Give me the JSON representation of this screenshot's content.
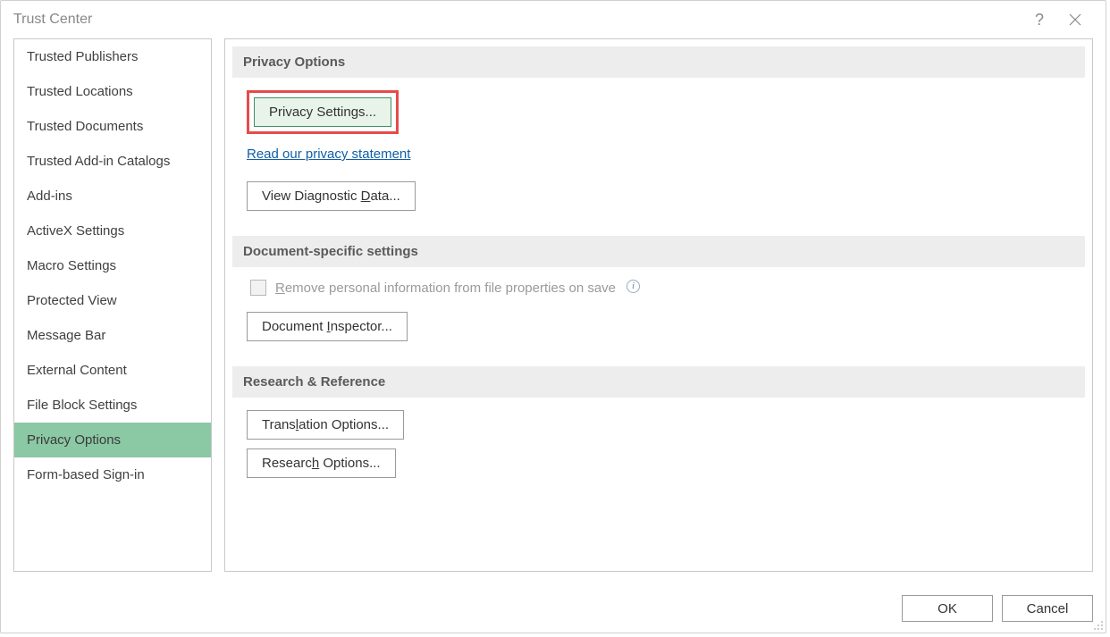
{
  "window": {
    "title": "Trust Center",
    "help_char": "?"
  },
  "sidebar": {
    "items": [
      "Trusted Publishers",
      "Trusted Locations",
      "Trusted Documents",
      "Trusted Add-in Catalogs",
      "Add-ins",
      "ActiveX Settings",
      "Macro Settings",
      "Protected View",
      "Message Bar",
      "External Content",
      "File Block Settings",
      "Privacy Options",
      "Form-based Sign-in"
    ],
    "selected_index": 11
  },
  "sections": {
    "privacy_options": {
      "header": "Privacy Options",
      "privacy_settings_btn": "Privacy Settings...",
      "privacy_link": "Read our privacy statement",
      "diagnostic_pre": "View Diagnostic ",
      "diagnostic_accel": "D",
      "diagnostic_post": "ata..."
    },
    "document_specific": {
      "header": "Document-specific settings",
      "checkbox_pre": "",
      "checkbox_accel": "R",
      "checkbox_post": "emove personal information from file properties on save",
      "inspector_pre": "Document ",
      "inspector_accel": "I",
      "inspector_post": "nspector..."
    },
    "research": {
      "header": "Research & Reference",
      "translation_pre": "Trans",
      "translation_accel": "l",
      "translation_post": "ation Options...",
      "research_pre": "Researc",
      "research_accel": "h",
      "research_post": " Options..."
    }
  },
  "footer": {
    "ok": "OK",
    "cancel": "Cancel"
  }
}
